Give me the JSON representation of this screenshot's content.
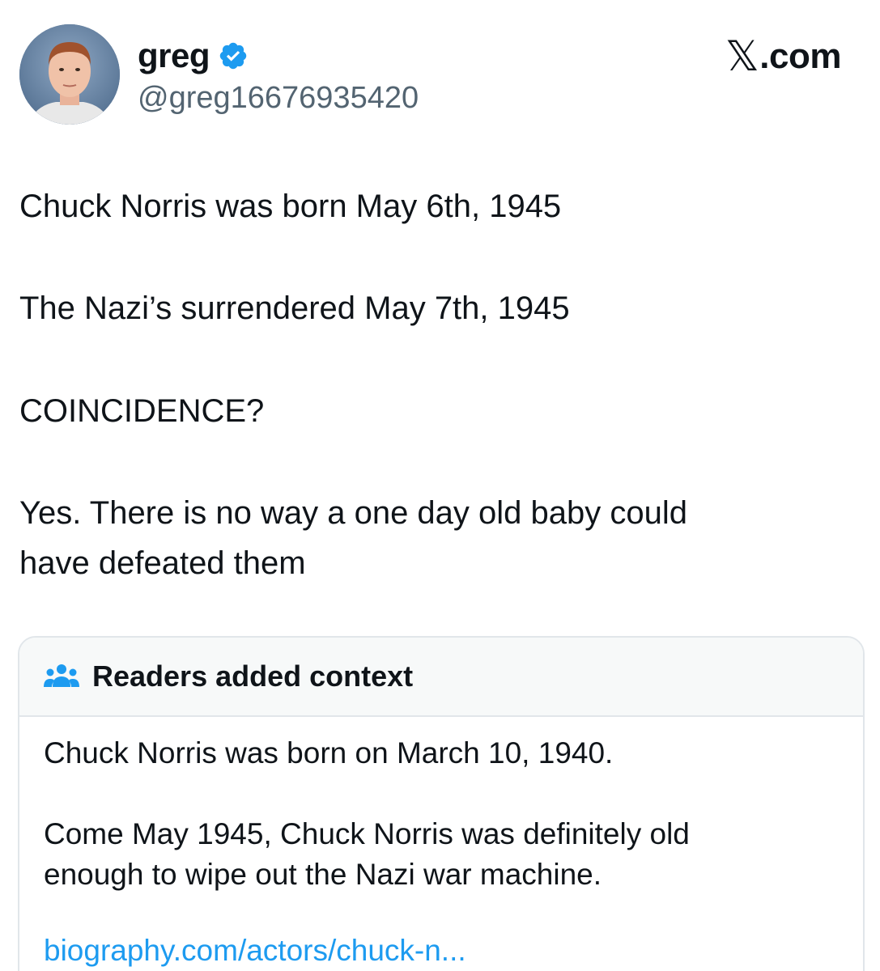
{
  "author": {
    "display_name": "greg",
    "handle": "@greg16676935420",
    "verified": true,
    "verified_color": "#1d9bf0",
    "avatar_icon": "profile-photo"
  },
  "brand": {
    "x_mark": "𝕏",
    "suffix": ".com"
  },
  "tweet": {
    "lines": [
      "Chuck Norris was born May 6th, 1945",
      "The Nazi’s surrendered May 7th, 1945",
      "COINCIDENCE?",
      "Yes. There is no way a one day old baby could",
      "have defeated them"
    ]
  },
  "community_note": {
    "icon": "people-icon",
    "title": "Readers added context",
    "lines": [
      "Chuck Norris was born on March 10, 1940.",
      "Come May 1945, Chuck Norris was definitely old",
      "enough to wipe out the Nazi war machine."
    ],
    "link": "biography.com/actors/chuck-n...",
    "link_color": "#1d9bf0"
  }
}
